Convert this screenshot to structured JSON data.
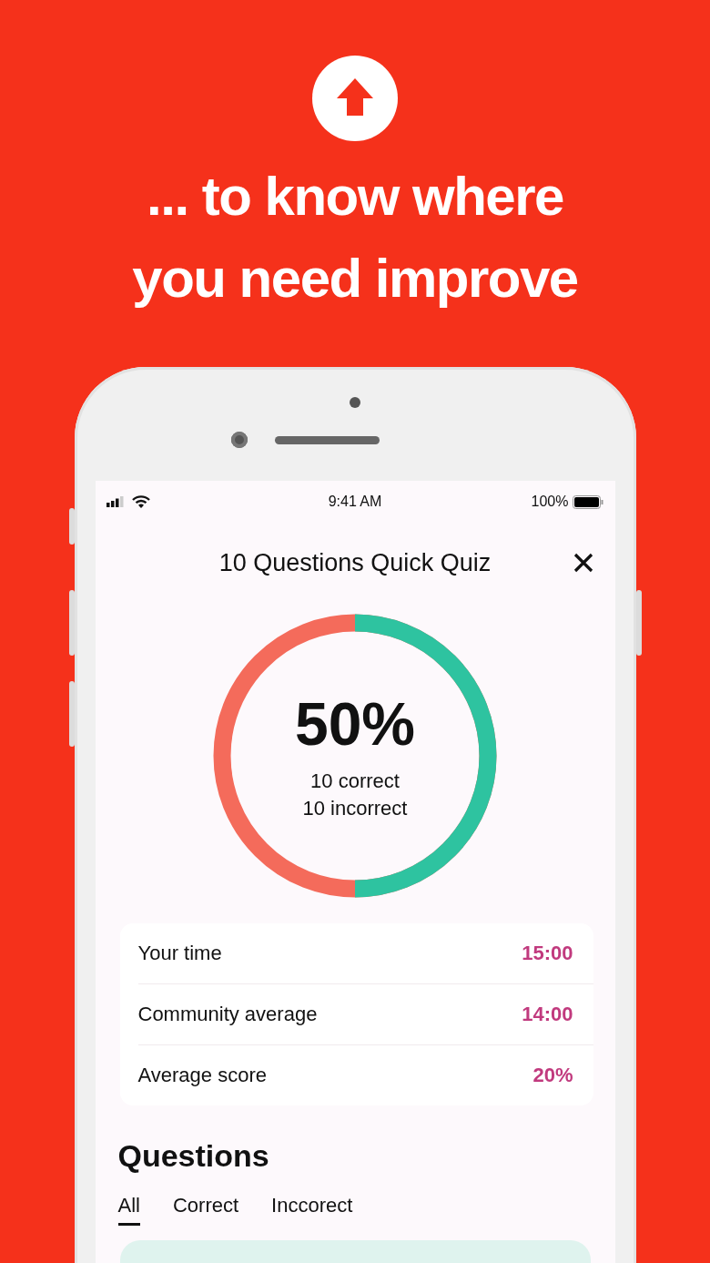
{
  "banner": {
    "headline_lines": [
      "... to know where",
      "you need improve"
    ]
  },
  "status_bar": {
    "time": "9:41 AM",
    "battery_text": "100%"
  },
  "quiz": {
    "title": "10 Questions Quick Quiz"
  },
  "result": {
    "percent": "50%",
    "correct_line": "10 correct",
    "incorrect_line": "10 incorrect",
    "level": 0.5
  },
  "stats": [
    {
      "label": "Your time",
      "value": "15:00"
    },
    {
      "label": "Community average",
      "value": "14:00"
    },
    {
      "label": "Average score",
      "value": "20%"
    }
  ],
  "questions": {
    "heading": "Questions",
    "tabs": [
      {
        "label": "All",
        "selected": true
      },
      {
        "label": "Correct",
        "selected": false
      },
      {
        "label": "Inccorect",
        "selected": false
      }
    ]
  }
}
